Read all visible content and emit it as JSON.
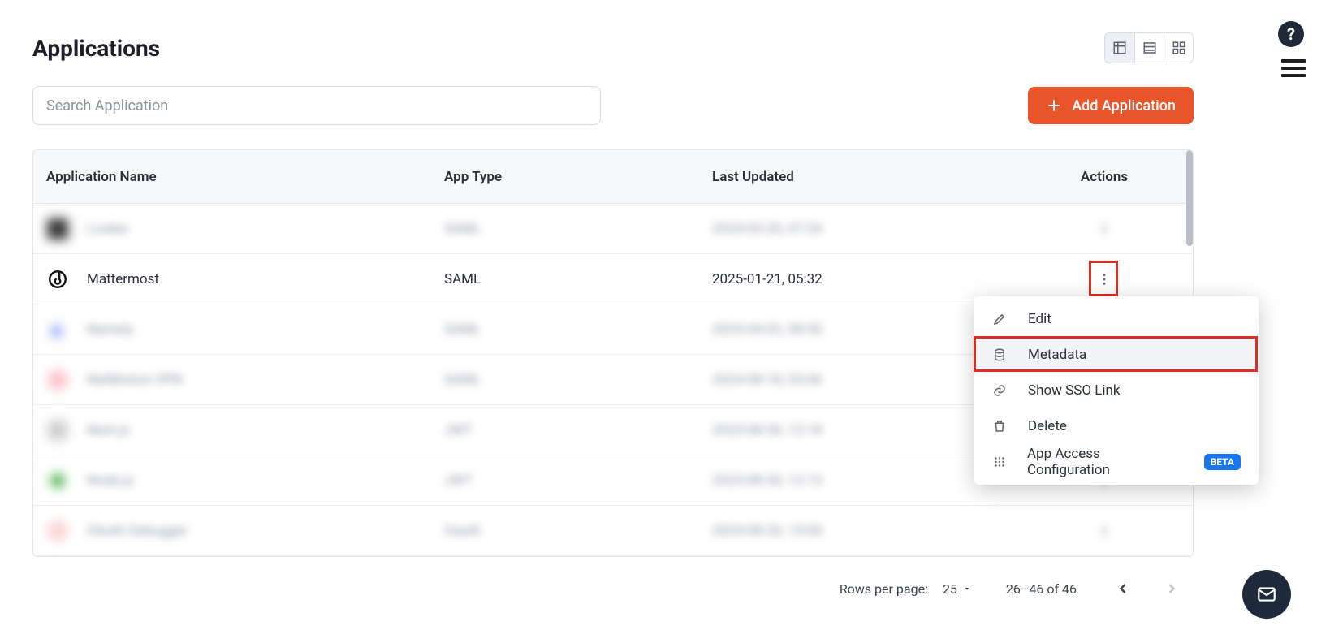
{
  "page": {
    "title": "Applications"
  },
  "search": {
    "placeholder": "Search Application"
  },
  "add_button": {
    "label": "Add Application"
  },
  "view_modes": {
    "table": "table-icon",
    "list": "list-icon",
    "grid": "grid-icon",
    "active": "table"
  },
  "table": {
    "columns": {
      "name": "Application Name",
      "type": "App Type",
      "updated": "Last Updated",
      "actions": "Actions"
    },
    "rows": [
      {
        "name": "Looker",
        "type": "SAML",
        "updated": "2024-03-20, 07:34",
        "icon": "looker-icon",
        "blurred": true
      },
      {
        "name": "Mattermost",
        "type": "SAML",
        "updated": "2025-01-21, 05:32",
        "icon": "mattermost-icon",
        "blurred": false
      },
      {
        "name": "Namely",
        "type": "SAML",
        "updated": "2024-04-02, 08:50",
        "icon": "namely-icon",
        "blurred": true
      },
      {
        "name": "NetMotion VPN",
        "type": "SAML",
        "updated": "2024-08-18, 05:06",
        "icon": "netmotion-icon",
        "blurred": true
      },
      {
        "name": "Next.js",
        "type": "JWT",
        "updated": "2023-08-30, 12:18",
        "icon": "nextjs-icon",
        "blurred": true
      },
      {
        "name": "Node.js",
        "type": "JWT",
        "updated": "2023-08-30, 12:13",
        "icon": "nodejs-icon",
        "blurred": true
      },
      {
        "name": "OAuth Debugger",
        "type": "Oauth",
        "updated": "2024-08-20, 15:00",
        "icon": "oauth-icon",
        "blurred": true
      }
    ]
  },
  "actions_menu": {
    "items": [
      {
        "key": "edit",
        "label": "Edit",
        "icon": "pencil-icon"
      },
      {
        "key": "metadata",
        "label": "Metadata",
        "icon": "database-icon",
        "highlighted": true
      },
      {
        "key": "sso",
        "label": "Show SSO Link",
        "icon": "link-icon"
      },
      {
        "key": "delete",
        "label": "Delete",
        "icon": "trash-icon"
      },
      {
        "key": "access",
        "label": "App Access Configuration",
        "icon": "grid-dots-icon",
        "badge": "BETA"
      }
    ],
    "badge_text": "BETA"
  },
  "pagination": {
    "rows_per_page_label": "Rows per page:",
    "rows_per_page_value": "25",
    "range": "26–46 of 46",
    "prev_enabled": true,
    "next_enabled": false
  },
  "fab": {
    "help": "?",
    "mail": "mail-icon",
    "burger": "menu-icon"
  }
}
